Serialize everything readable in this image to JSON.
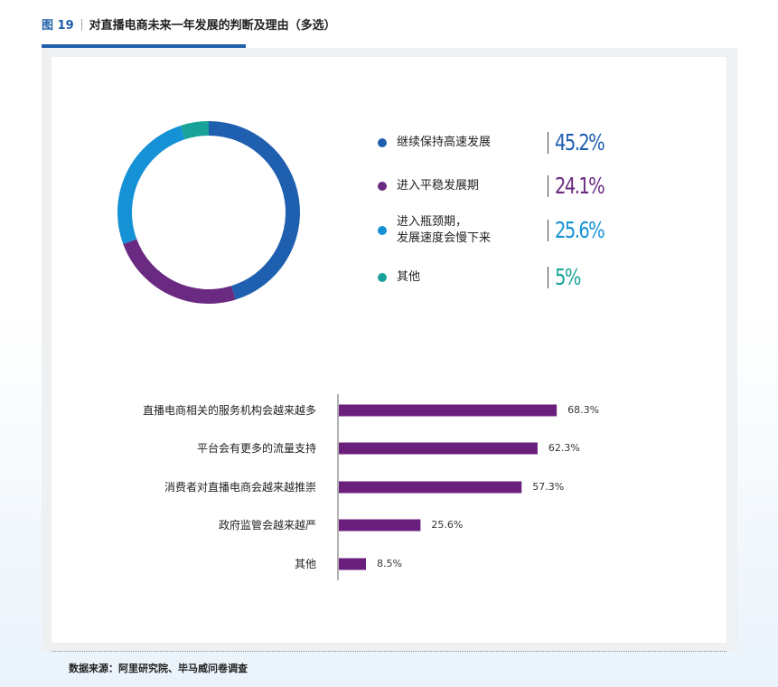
{
  "figure": {
    "number": "图 19",
    "title": "对直播电商未来一年发展的判断及理由（多选）"
  },
  "source": "数据来源：阿里研究院、毕马威问卷调查",
  "chart_data": [
    {
      "type": "pie",
      "donut": true,
      "slices": [
        {
          "label": "继续保持高速发展",
          "value": 45.2,
          "value_text": "45.2%",
          "color": "#1f5fb0"
        },
        {
          "label": "进入平稳发展期",
          "value": 24.1,
          "value_text": "24.1%",
          "color": "#6b2a82"
        },
        {
          "label": "进入瓶颈期，\n发展速度会慢下来",
          "label_lines": [
            "进入瓶颈期，",
            "发展速度会慢下来"
          ],
          "value": 25.6,
          "value_text": "25.6%",
          "color": "#1592d6"
        },
        {
          "label": "其他",
          "value": 5,
          "value_text": "5%",
          "color": "#17a39a"
        }
      ],
      "legend_position": "right"
    },
    {
      "type": "bar",
      "orientation": "horizontal",
      "categories": [
        "直播电商相关的服务机构会越来越多",
        "平台会有更多的流量支持",
        "消费者对直播电商会越来越推崇",
        "政府监管会越来越严",
        "其他"
      ],
      "values": [
        68.3,
        62.3,
        57.3,
        25.6,
        8.5
      ],
      "value_labels": [
        "68.3%",
        "62.3%",
        "57.3%",
        "25.6%",
        "8.5%"
      ],
      "color": "#6b1f7c",
      "grid": false
    }
  ]
}
